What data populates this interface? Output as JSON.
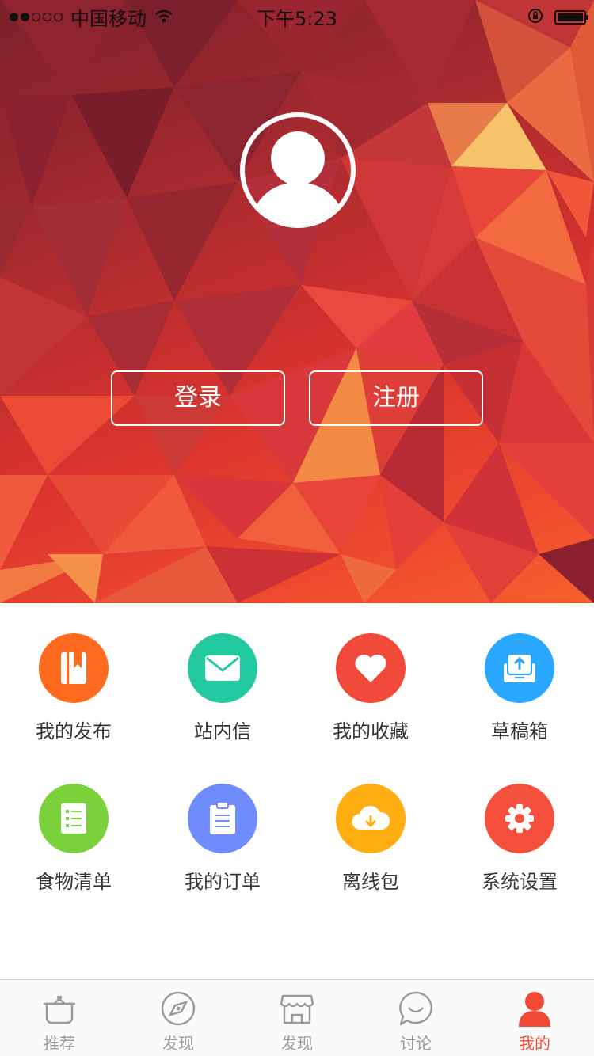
{
  "status_bar": {
    "carrier": "中国移动",
    "time": "下午5:23"
  },
  "auth": {
    "login_label": "登录",
    "register_label": "注册"
  },
  "menu": {
    "items": [
      {
        "label": "我的发布",
        "icon": "bookmark-book-icon",
        "color": "#ff6a1f"
      },
      {
        "label": "站内信",
        "icon": "envelope-icon",
        "color": "#22c99e"
      },
      {
        "label": "我的收藏",
        "icon": "heart-icon",
        "color": "#f24a3a"
      },
      {
        "label": "草稿箱",
        "icon": "upload-tray-icon",
        "color": "#2aa8ff"
      },
      {
        "label": "食物清单",
        "icon": "list-icon",
        "color": "#7ad13a"
      },
      {
        "label": "我的订单",
        "icon": "clipboard-icon",
        "color": "#6f8cff"
      },
      {
        "label": "离线包",
        "icon": "cloud-download-icon",
        "color": "#ffae12"
      },
      {
        "label": "系统设置",
        "icon": "gear-icon",
        "color": "#f5503d"
      }
    ]
  },
  "tabbar": {
    "tabs": [
      {
        "label": "推荐",
        "icon": "pot-icon",
        "active": false
      },
      {
        "label": "发现",
        "icon": "compass-icon",
        "active": false
      },
      {
        "label": "发现",
        "icon": "store-icon",
        "active": false
      },
      {
        "label": "讨论",
        "icon": "chat-bubble-icon",
        "active": false
      },
      {
        "label": "我的",
        "icon": "person-icon",
        "active": true
      }
    ],
    "active_color": "#f04a36",
    "inactive_color": "#999999"
  }
}
